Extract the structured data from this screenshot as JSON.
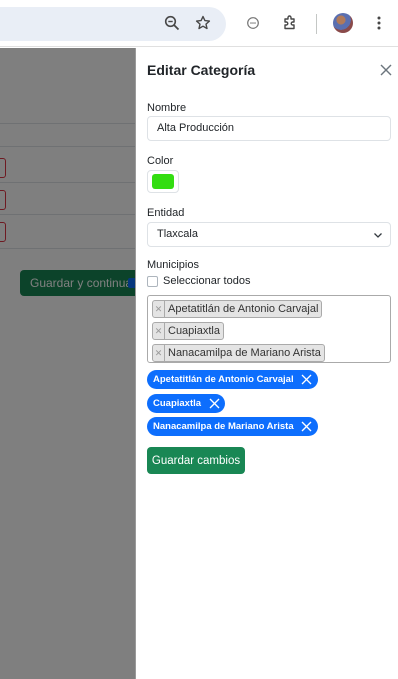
{
  "browser": {
    "icons": [
      "zoom-icon",
      "star-icon",
      "chat-icon",
      "extensions-icon",
      "profile-avatar",
      "more-menu-icon"
    ]
  },
  "background_page": {
    "button_label": "Guardar y continuar"
  },
  "panel": {
    "title": "Editar Categoría",
    "name": {
      "label": "Nombre",
      "value": "Alta Producción"
    },
    "color": {
      "label": "Color",
      "value": "#33dd11"
    },
    "entity": {
      "label": "Entidad",
      "selected": "Tlaxcala"
    },
    "municipalities": {
      "label": "Municipios",
      "select_all_label": "Seleccionar todos",
      "select_all_checked": false,
      "selected": [
        "Apetatitlán de Antonio Carvajal",
        "Cuapiaxtla",
        "Nanacamilpa de Mariano Arista"
      ]
    },
    "chips": [
      "Apetatitlán de Antonio Carvajal",
      "Cuapiaxtla",
      "Nanacamilpa de Mariano Arista"
    ],
    "submit_label": "Guardar cambios"
  },
  "colors": {
    "primary": "#0d6efd",
    "success": "#198754",
    "danger": "#dc3545",
    "backdrop": "rgba(0,0,0,0.5)"
  }
}
